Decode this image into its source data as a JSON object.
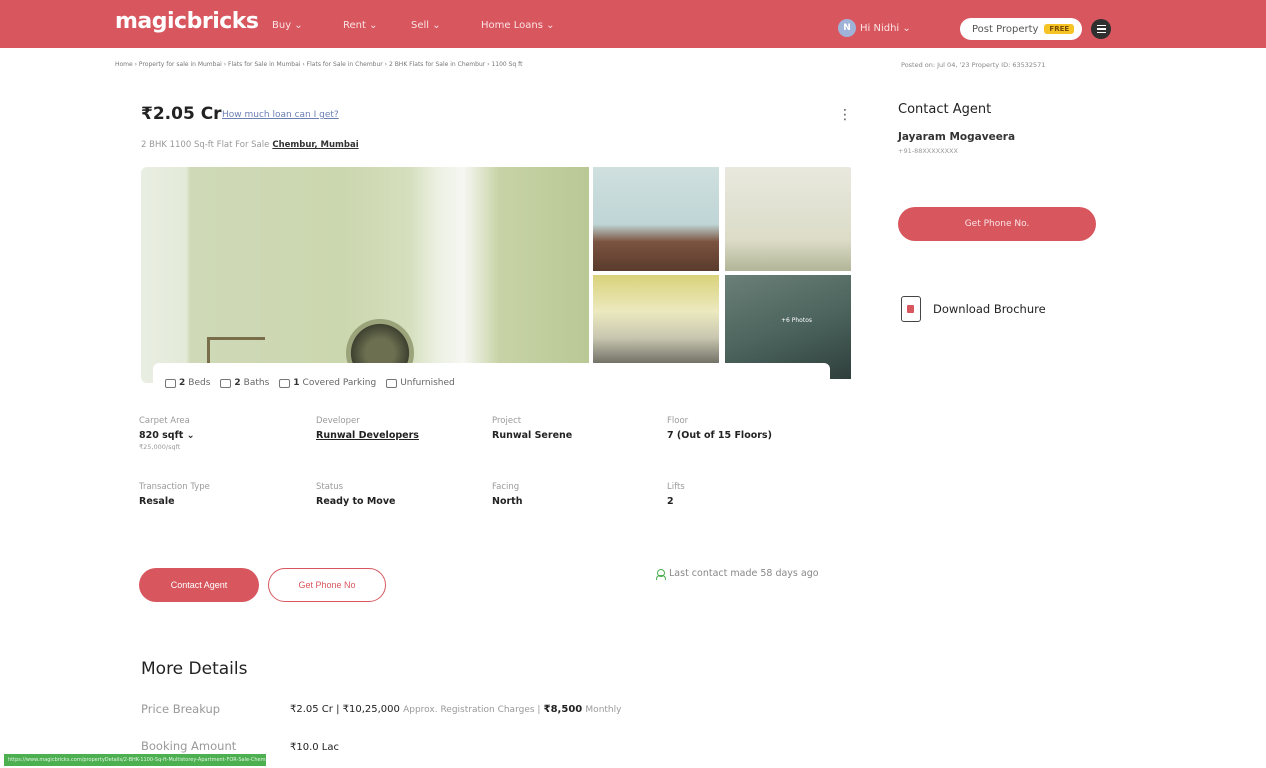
{
  "header": {
    "logo": "magicbricks",
    "nav": [
      "Buy ⌄",
      "Rent ⌄",
      "Sell ⌄",
      "Home Loans ⌄"
    ],
    "user_initial": "N",
    "user_label": "Hi Nidhi ⌄",
    "post_property": "Post Property",
    "free_badge": "FREE"
  },
  "breadcrumb": "Home › Property for sale in Mumbai › Flats for Sale in Mumbai › Flats for Sale in Chembur › 2 BHK Flats for Sale in Chembur › 1100 Sq ft",
  "posted": "Posted on: Jul 04, '23     Property ID: 63532571",
  "listing": {
    "price": "₹2.05 Cr",
    "loan_link": "How much loan can I get?",
    "subtitle": "2 BHK 1100 Sq-ft Flat For Sale",
    "location": "Chembur, Mumbai",
    "photo_count": "+6 Photos",
    "features": {
      "beds_num": "2",
      "beds": "Beds",
      "baths_num": "2",
      "baths": "Baths",
      "parking_num": "1",
      "parking": "Covered Parking",
      "furnishing": "Unfurnished"
    }
  },
  "summary": {
    "carpet_area_label": "Carpet Area",
    "carpet_area": "820 sqft ⌄",
    "carpet_rate": "₹25,000/sqft",
    "developer_label": "Developer",
    "developer": "Runwal Developers",
    "project_label": "Project",
    "project": "Runwal Serene",
    "floor_label": "Floor",
    "floor": "7 (Out of 15 Floors)",
    "transaction_label": "Transaction Type",
    "transaction": "Resale",
    "status_label": "Status",
    "status": "Ready to Move",
    "facing_label": "Facing",
    "facing": "North",
    "lifts_label": "Lifts",
    "lifts": "2"
  },
  "actions": {
    "contact_agent": "Contact Agent",
    "get_phone": "Get Phone No",
    "last_contact": "Last contact made 58 days ago"
  },
  "more_details": {
    "title": "More Details",
    "price_breakup_label": "Price Breakup",
    "price_breakup_a": "₹2.05 Cr | ₹10,25,000",
    "price_breakup_b": "Approx. Registration Charges |",
    "price_breakup_c": "₹8,500",
    "price_breakup_d": "Monthly",
    "booking_label": "Booking Amount",
    "booking": "₹10.0 Lac"
  },
  "sidebar": {
    "title": "Contact Agent",
    "agent_name": "Jayaram Mogaveera",
    "agent_phone": "+91-88XXXXXXXX",
    "get_phone": "Get Phone No.",
    "brochure": "Download Brochure"
  },
  "status_bar": "https://www.magicbricks.com/propertyDetails/2-BHK-1100-Sq-ft-Multistorey-Apartment-FOR-Sale-Chembur-in-Mumbai&id=4d423633353235373"
}
